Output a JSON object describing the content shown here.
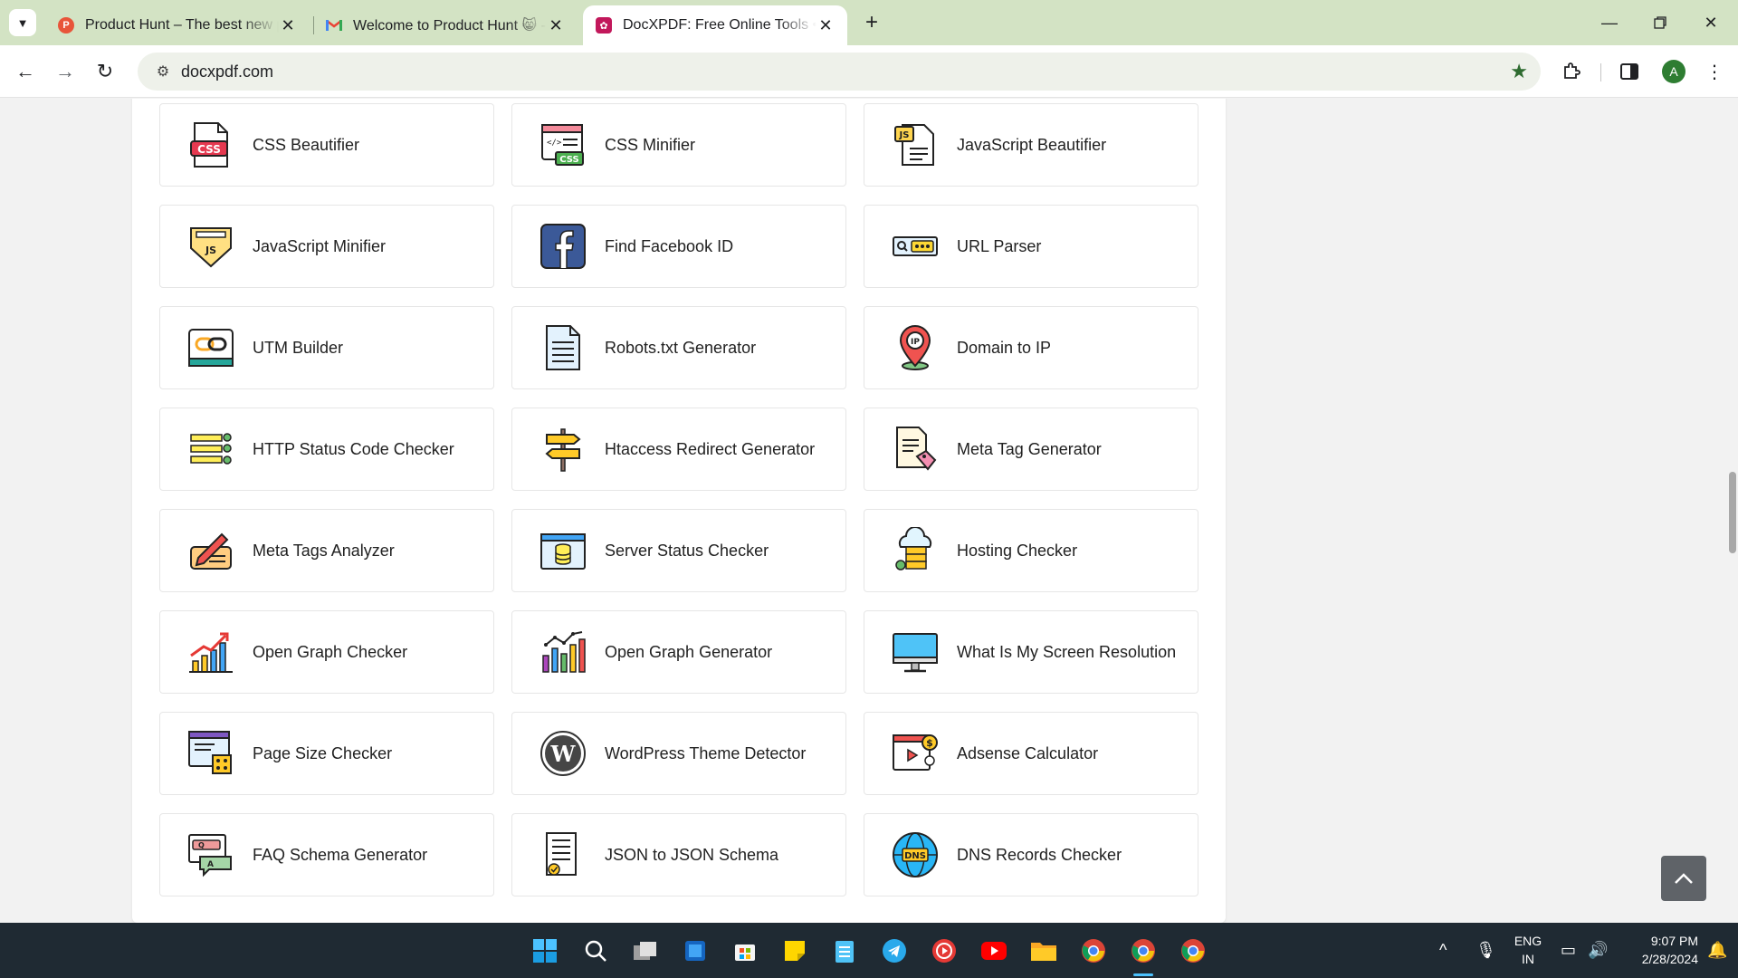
{
  "browser": {
    "tabs": [
      {
        "title": "Product Hunt – The best new products",
        "favicon": "product-hunt-icon",
        "color": "#e8553a",
        "letter": "P",
        "active": false
      },
      {
        "title": "Welcome to Product Hunt 😸 - Gmail",
        "favicon": "gmail-icon",
        "color": "#ea4335",
        "letter": "M",
        "active": false
      },
      {
        "title": "DocXPDF: Free Online Tools • Free",
        "favicon": "docxpdf-icon",
        "color": "#c2185b",
        "letter": "✿",
        "active": true
      }
    ],
    "tab_close": "✕",
    "new_tab": "+",
    "address": "docxpdf.com",
    "profile_initial": "A"
  },
  "tools": [
    {
      "name": "CSS Beautifier",
      "icon": "css-file-icon"
    },
    {
      "name": "CSS Minifier",
      "icon": "css-code-window-icon"
    },
    {
      "name": "JavaScript Beautifier",
      "icon": "js-file-icon"
    },
    {
      "name": "JavaScript Minifier",
      "icon": "js-shield-icon"
    },
    {
      "name": "Find Facebook ID",
      "icon": "facebook-icon"
    },
    {
      "name": "URL Parser",
      "icon": "url-search-bar-icon"
    },
    {
      "name": "UTM Builder",
      "icon": "link-chain-icon"
    },
    {
      "name": "Robots.txt Generator",
      "icon": "text-document-icon"
    },
    {
      "name": "Domain to IP",
      "icon": "ip-location-pin-icon"
    },
    {
      "name": "HTTP Status Code Checker",
      "icon": "server-status-list-icon"
    },
    {
      "name": "Htaccess Redirect Generator",
      "icon": "signpost-icon"
    },
    {
      "name": "Meta Tag Generator",
      "icon": "document-tag-icon"
    },
    {
      "name": "Meta Tags Analyzer",
      "icon": "pencil-writing-icon"
    },
    {
      "name": "Server Status Checker",
      "icon": "database-window-icon"
    },
    {
      "name": "Hosting Checker",
      "icon": "cloud-server-icon"
    },
    {
      "name": "Open Graph Checker",
      "icon": "growth-bar-chart-icon"
    },
    {
      "name": "Open Graph Generator",
      "icon": "analytics-chart-icon"
    },
    {
      "name": "What Is My Screen Resolution",
      "icon": "desktop-monitor-icon"
    },
    {
      "name": "Page Size Checker",
      "icon": "webpage-ruler-icon"
    },
    {
      "name": "WordPress Theme Detector",
      "icon": "wordpress-icon"
    },
    {
      "name": "Adsense Calculator",
      "icon": "video-dollar-icon"
    },
    {
      "name": "FAQ Schema Generator",
      "icon": "faq-chat-icon"
    },
    {
      "name": "JSON to JSON Schema",
      "icon": "json-document-icon"
    },
    {
      "name": "DNS Records Checker",
      "icon": "dns-globe-icon"
    }
  ],
  "taskbar": {
    "language": "ENG",
    "region": "IN",
    "time": "9:07 PM",
    "date": "2/28/2024"
  }
}
